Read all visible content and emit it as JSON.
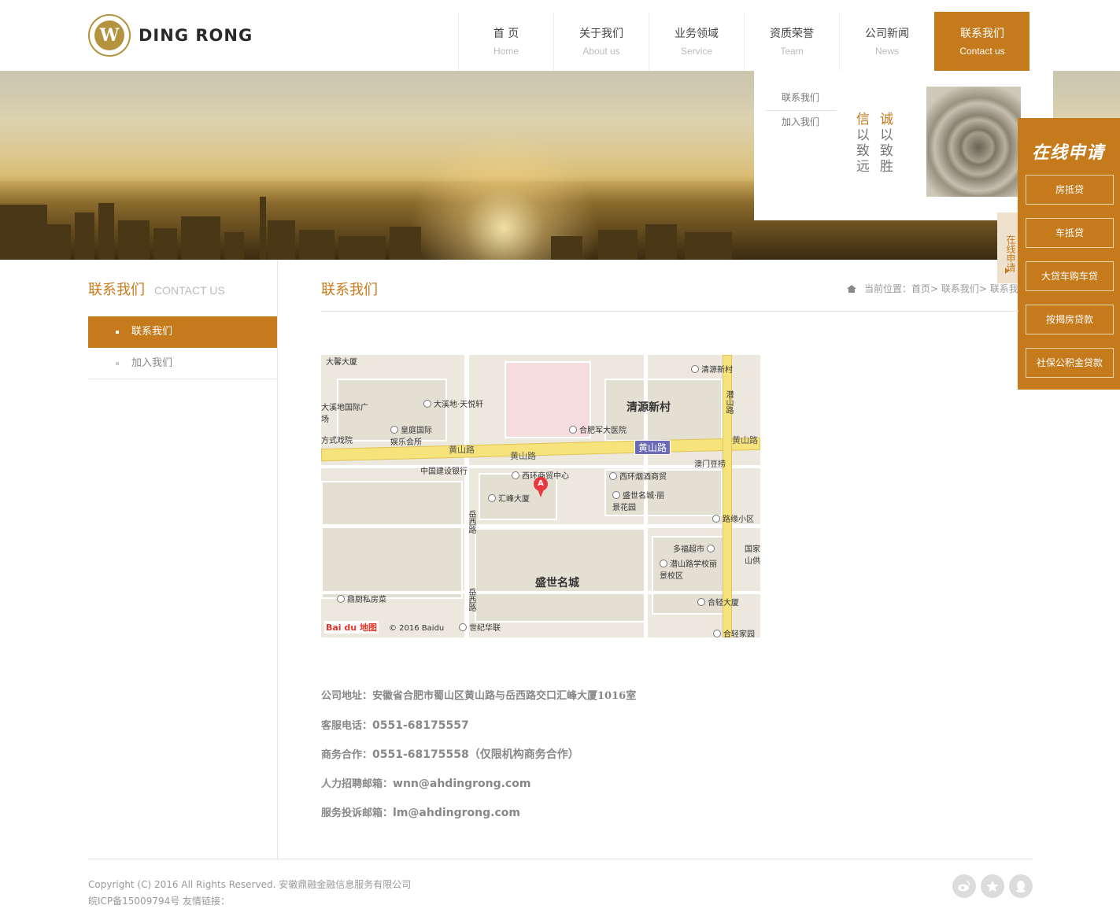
{
  "header": {
    "logo_text": "DING RONG",
    "nav": [
      {
        "cn": "首 页",
        "en": "Home"
      },
      {
        "cn": "关于我们",
        "en": "About us"
      },
      {
        "cn": "业务领域",
        "en": "Service"
      },
      {
        "cn": "资质荣誉",
        "en": "Team"
      },
      {
        "cn": "公司新闻",
        "en": "News"
      },
      {
        "cn": "联系我们",
        "en": "Contact us"
      }
    ],
    "active_index": 5
  },
  "dropdown": {
    "links": [
      "联系我们",
      "加入我们"
    ],
    "slogan_col1": [
      "信",
      "以",
      "致",
      "远"
    ],
    "slogan_col2": [
      "诚",
      "以",
      "致",
      "胜"
    ]
  },
  "side_tab": {
    "label": "在线申请"
  },
  "apply_panel": {
    "title": "在线申请",
    "buttons": [
      "房抵贷",
      "车抵贷",
      "大贷车购车贷",
      "按揭房贷款",
      "社保公积金贷款"
    ]
  },
  "sidebar": {
    "title": "联系我们",
    "title_en": "CONTACT US",
    "items": [
      "联系我们",
      "加入我们"
    ],
    "active_index": 0
  },
  "main": {
    "title": "联系我们",
    "breadcrumb": "当前位置：首页> 联系我们> 联系我们"
  },
  "map": {
    "labels": [
      "大馨大厦",
      "清源新村",
      "大溪地·天悦轩",
      "大溪地国际广场",
      "合肥军大医院",
      "皇庭国际娱乐会所",
      "方式戏院",
      "黄山路",
      "黄山路",
      "黄山路",
      "黄山路",
      "中国建设银行",
      "西环商贸中心",
      "西环烟酒商贸",
      "澳门豆捞",
      "汇峰大厦",
      "盛世名城·丽景花园",
      "潜山路",
      "路缘小区",
      "岳西路",
      "多福超市",
      "潜山路学校丽景校区",
      "国家山供",
      "盛世名城",
      "鼎厨私房菜",
      "岳西路",
      "合轻大厦",
      "世纪华联",
      "合轻家园",
      "清源新村"
    ],
    "pin_label": "A",
    "logo": "Bai du 地图",
    "copyright": "© 2016 Baidu"
  },
  "contact": {
    "address_label": "公司地址：",
    "address": "安徽省合肥市蜀山区黄山路与岳西路交口汇峰大厦1016室",
    "service_phone_label": "客服电话：",
    "service_phone": "0551-68175557",
    "business_label": "商务合作：",
    "business": "0551-68175558（仅限机构商务合作）",
    "hr_label": "人力招聘邮箱：",
    "hr_email": "wnn@ahdingrong.com",
    "complaint_label": "服务投诉邮箱：",
    "complaint_email": "lm@ahdingrong.com"
  },
  "footer": {
    "copyright": "Copyright (C) 2016 All Rights Reserved. 安徽鼎融金融信息服务有限公司",
    "icp": "皖ICP备15009794号 友情链接：",
    "social_icons": [
      "weibo-icon",
      "star-icon",
      "qq-icon"
    ]
  },
  "colors": {
    "accent": "#c57a1c",
    "logo_gold": "#b4933f"
  }
}
